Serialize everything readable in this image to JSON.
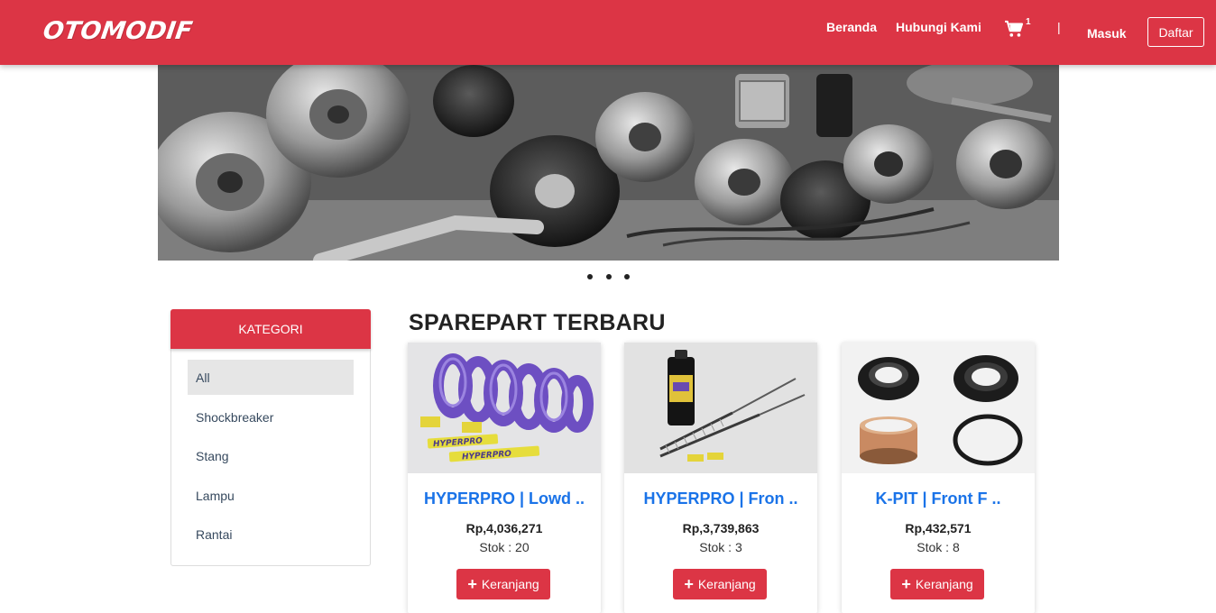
{
  "navbar": {
    "brand": "OTOMODIF",
    "links": {
      "home": "Beranda",
      "contact": "Hubungi Kami"
    },
    "cart_count": "1",
    "separator": "|",
    "login": "Masuk",
    "register": "Daftar"
  },
  "colors": {
    "primary": "#dc3545",
    "link": "#1a73e8"
  },
  "carousel": {
    "slide_count": 3,
    "active_index": 0
  },
  "sidebar": {
    "header": "KATEGORI",
    "items": [
      {
        "label": "All",
        "active": true
      },
      {
        "label": "Shockbreaker"
      },
      {
        "label": "Stang"
      },
      {
        "label": "Lampu"
      },
      {
        "label": "Rantai"
      }
    ]
  },
  "products_section": {
    "title": "SPAREPART TERBARU",
    "button_label": "Keranjang",
    "items": [
      {
        "title": "HYPERPRO | Lowd ..",
        "price": "Rp,4,036,271",
        "stock": "Stok : 20",
        "image": "purple-spring"
      },
      {
        "title": "HYPERPRO | Fron ..",
        "price": "Rp,3,739,863",
        "stock": "Stok : 3",
        "image": "fork-springs-oil"
      },
      {
        "title": "K-PIT | Front F ..",
        "price": "Rp,432,571",
        "stock": "Stok : 8",
        "image": "seals-bushing"
      }
    ]
  }
}
